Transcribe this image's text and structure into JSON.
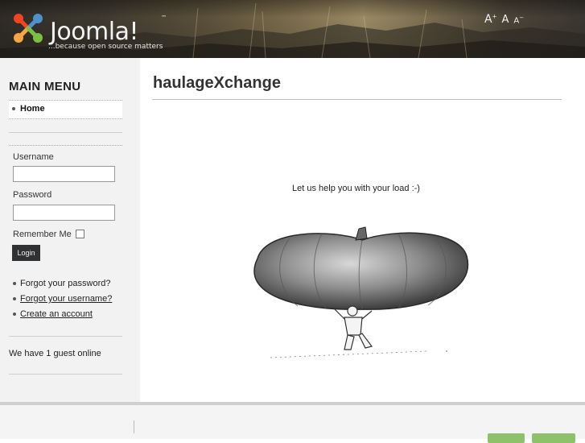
{
  "header": {
    "logo_text": "Joomla!",
    "logo_tm": "™",
    "tagline": "...because open source matters",
    "font_controls": {
      "bigger": "A",
      "reset": "A",
      "smaller": "A"
    }
  },
  "sidebar": {
    "menu_title": "MAIN MENU",
    "menu_items": [
      {
        "label": "Home"
      }
    ],
    "login": {
      "username_label": "Username",
      "username_value": "",
      "password_label": "Password",
      "password_value": "",
      "remember_label": "Remember Me",
      "login_button": "Login"
    },
    "links": [
      {
        "label": "Forgot your password?"
      },
      {
        "label": "Forgot your username?"
      },
      {
        "label": "Create an account"
      }
    ],
    "guest_text": "We have 1 guest online"
  },
  "main": {
    "title": "haulageXchange",
    "tagline": "Let us help you with your load :-)"
  },
  "colors": {
    "sidebar_bg": "#f2f2f2",
    "login_button_bg": "#2f3133",
    "badge_green": "#8dc26b"
  }
}
